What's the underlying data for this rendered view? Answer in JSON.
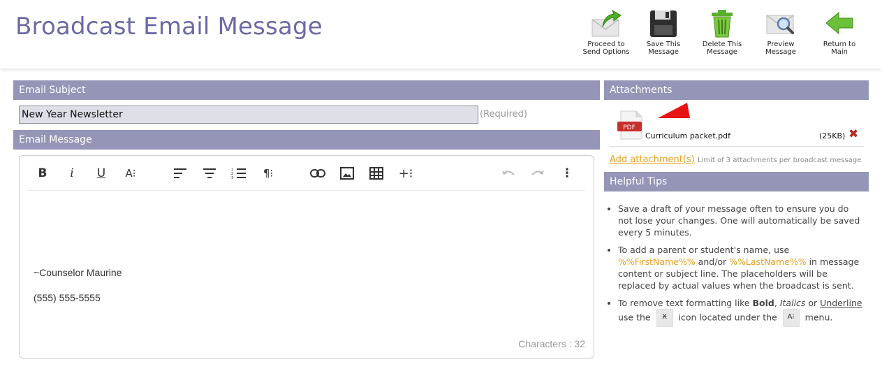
{
  "page": {
    "title": "Broadcast Email Message"
  },
  "toolbar": {
    "proceed": "Proceed to\nSend Options",
    "save": "Save This\nMessage",
    "delete": "Delete This\nMessage",
    "preview": "Preview\nMessage",
    "return": "Return to\nMain"
  },
  "subject": {
    "header": "Email Subject",
    "value": "New Year Newsletter",
    "required": "(Required)"
  },
  "message": {
    "header": "Email Message",
    "lines": [
      "~Counselor Maurine",
      "(555) 555-5555"
    ],
    "char_count": "Characters : 32"
  },
  "attachments": {
    "header": "Attachments",
    "file_badge": "PDF",
    "file_name": "Curriculum packet.pdf",
    "file_size": "(25KB)",
    "delete_symbol": "✖",
    "add_link": "Add attachment(s)",
    "limit": "Limit of 3 attachments per broadcast message"
  },
  "tips": {
    "header": "Helpful Tips",
    "tip1": "Save a draft of your message often to ensure you do not lose your changes. One will automatically be saved every 5 minutes.",
    "tip2_a": "To add a parent or student's name, use ",
    "tip2_first": "%%FirstName%%",
    "tip2_b": " and/or ",
    "tip2_last": "%%LastName%%",
    "tip2_c": " in message content or subject line. The placeholders will be replaced by actual values when the broadcast is sent.",
    "tip3_a": "To remove text formatting like ",
    "tip3_bold": "Bold",
    "tip3_comma": ", ",
    "tip3_italics": "Italics",
    "tip3_or": " or ",
    "tip3_underline": "Underline",
    "tip3_use": " use the ",
    "tip3_icon1": "Ӿ",
    "tip3_mid": " icon located under the ",
    "tip3_icon2": "A⁝",
    "tip3_end": " menu."
  },
  "editor_tools": {
    "bold": "B",
    "italic": "i",
    "underline": "U",
    "font_size": "A⁝",
    "paragraph": "¶⁝",
    "insert_more": "+⁝",
    "more": "⋮"
  }
}
